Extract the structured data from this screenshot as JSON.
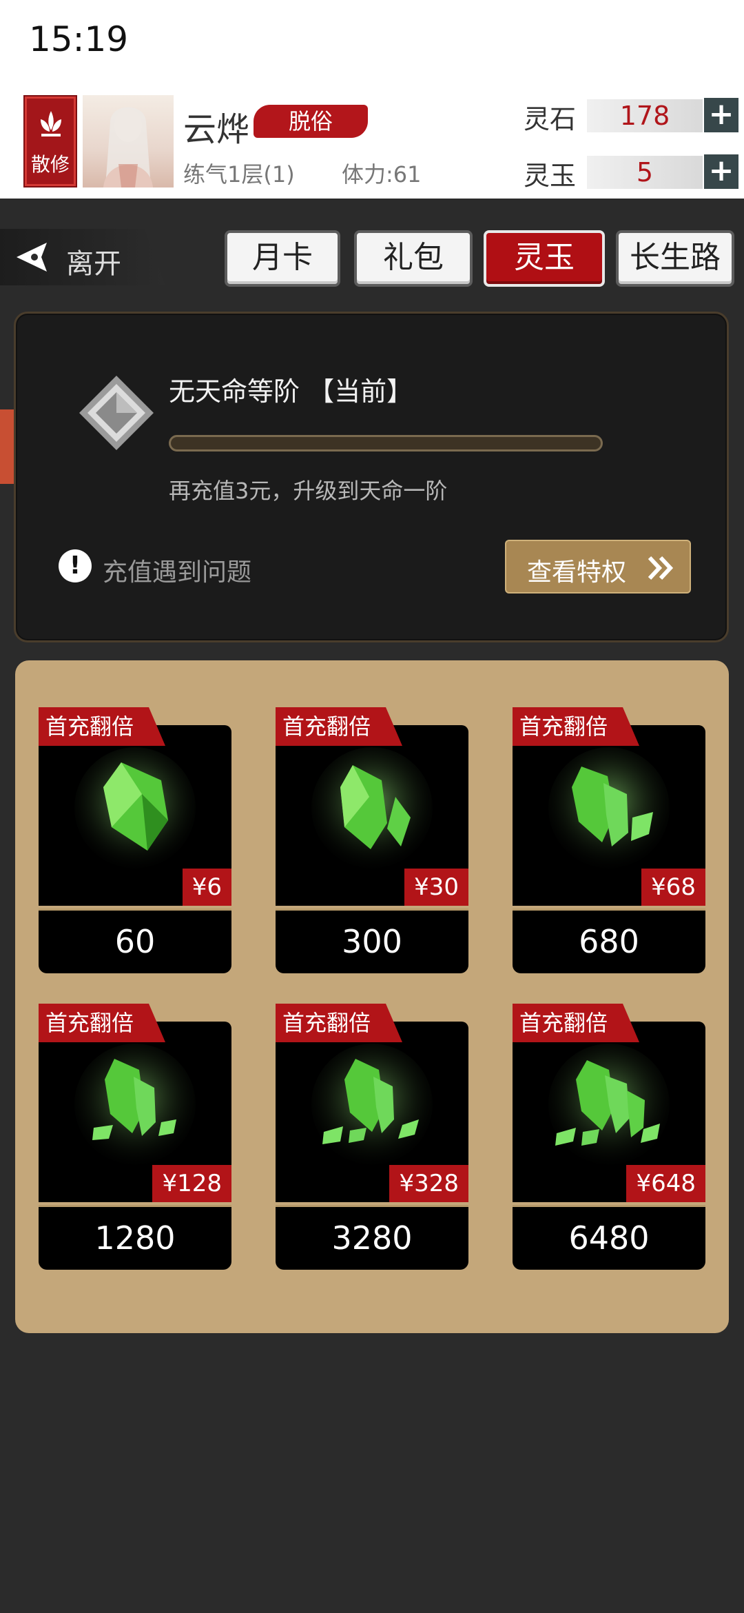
{
  "status_bar": {
    "time": "15:19"
  },
  "profile": {
    "sect_label": "散修",
    "name": "云烨",
    "rank": "脱俗",
    "realm": "练气1层(1)",
    "stamina": "体力:61"
  },
  "currencies": [
    {
      "label": "灵石",
      "value": "178",
      "plus": "+"
    },
    {
      "label": "灵玉",
      "value": "5",
      "plus": "+"
    }
  ],
  "nav": {
    "leave_label": "离开",
    "tabs": [
      {
        "label": "月卡",
        "active": false
      },
      {
        "label": "礼包",
        "active": false
      },
      {
        "label": "灵玉",
        "active": true
      },
      {
        "label": "长生路",
        "active": false
      }
    ]
  },
  "vip": {
    "title": "无天命等阶 【当前】",
    "progress_fraction": 0.0,
    "hint": "再充值3元，升级到天命一阶",
    "issue_label": "充值遇到问题",
    "issue_icon": "!",
    "privilege_label": "查看特权"
  },
  "packs": [
    {
      "ribbon": "首充翻倍",
      "price": "¥6",
      "amount": "60"
    },
    {
      "ribbon": "首充翻倍",
      "price": "¥30",
      "amount": "300"
    },
    {
      "ribbon": "首充翻倍",
      "price": "¥68",
      "amount": "680"
    },
    {
      "ribbon": "首充翻倍",
      "price": "¥128",
      "amount": "1280"
    },
    {
      "ribbon": "首充翻倍",
      "price": "¥328",
      "amount": "3280"
    },
    {
      "ribbon": "首充翻倍",
      "price": "¥648",
      "amount": "6480"
    }
  ],
  "colors": {
    "accent_red": "#b21418",
    "panel_gold": "#c4a77a",
    "crystal_green": "#4ecb3a"
  }
}
